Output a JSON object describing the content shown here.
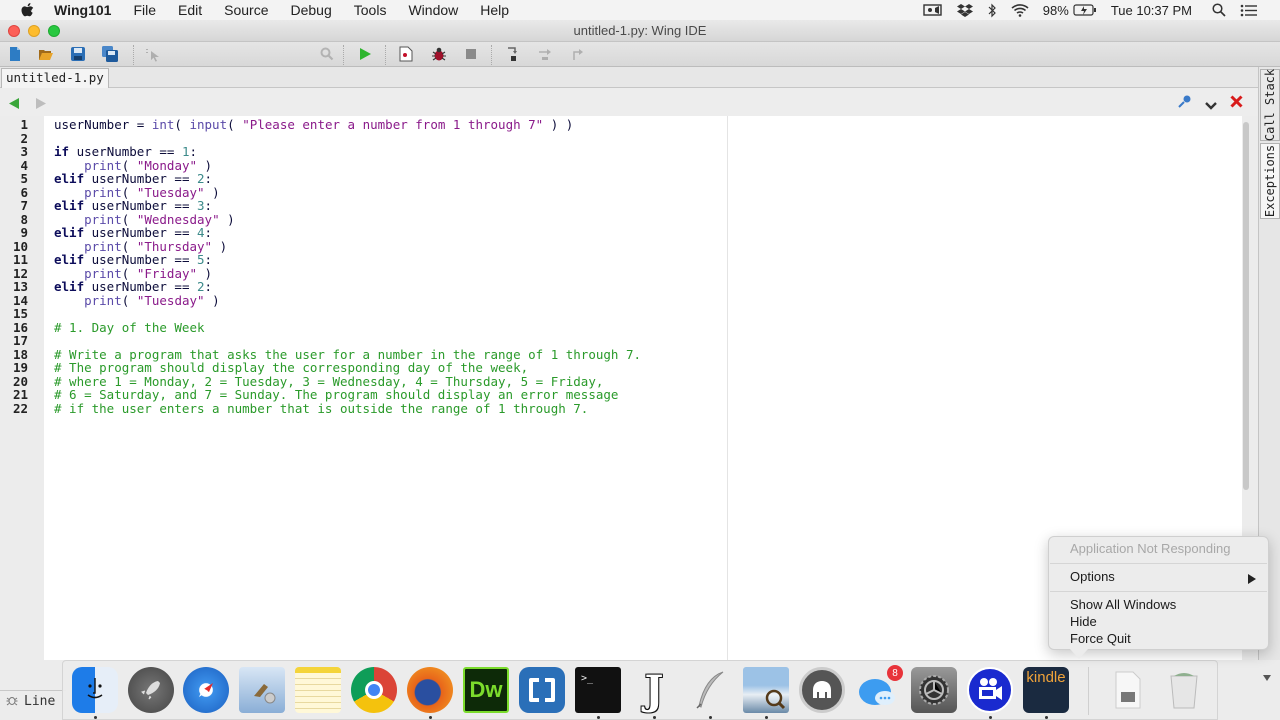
{
  "menubar": {
    "app_name": "Wing101",
    "items": [
      "File",
      "Edit",
      "Source",
      "Debug",
      "Tools",
      "Window",
      "Help"
    ],
    "battery": "98%",
    "clock": "Tue 10:37 PM",
    "status_icons": [
      "screen-record-icon",
      "dropbox-icon",
      "bluetooth-icon",
      "wifi-icon",
      "battery-icon",
      "spotlight-icon",
      "notification-center-icon"
    ]
  },
  "window": {
    "title": "untitled-1.py: Wing IDE"
  },
  "toolbar": {
    "search_value": "",
    "buttons": [
      "new-file",
      "open-file",
      "save",
      "save-all",
      "pointer",
      "search",
      "run",
      "debug-file",
      "debug",
      "stop",
      "step-into",
      "step-over",
      "step-out"
    ]
  },
  "editor": {
    "tab_label": "untitled-1.py",
    "line_numbers": [
      "1",
      "2",
      "3",
      "4",
      "5",
      "6",
      "7",
      "8",
      "9",
      "10",
      "11",
      "12",
      "13",
      "14",
      "15",
      "16",
      "17",
      "18",
      "19",
      "20",
      "21",
      "22"
    ],
    "lines": [
      {
        "parts": [
          [
            "id",
            "userNumber = "
          ],
          [
            "bi",
            "int"
          ],
          [
            "id",
            "( "
          ],
          [
            "bi",
            "input"
          ],
          [
            "id",
            "( "
          ],
          [
            "str",
            "\"Please enter a number from 1 through 7\""
          ],
          [
            "id",
            " ) )"
          ]
        ]
      },
      {
        "parts": []
      },
      {
        "parts": [
          [
            "kw",
            "if"
          ],
          [
            "id",
            " userNumber == "
          ],
          [
            "num",
            "1"
          ],
          [
            "id",
            ":"
          ]
        ]
      },
      {
        "parts": [
          [
            "id",
            "    "
          ],
          [
            "bi",
            "print"
          ],
          [
            "id",
            "( "
          ],
          [
            "str",
            "\"Monday\""
          ],
          [
            "id",
            " )"
          ]
        ]
      },
      {
        "parts": [
          [
            "kw",
            "elif"
          ],
          [
            "id",
            " userNumber == "
          ],
          [
            "num",
            "2"
          ],
          [
            "id",
            ":"
          ]
        ]
      },
      {
        "parts": [
          [
            "id",
            "    "
          ],
          [
            "bi",
            "print"
          ],
          [
            "id",
            "( "
          ],
          [
            "str",
            "\"Tuesday\""
          ],
          [
            "id",
            " )"
          ]
        ]
      },
      {
        "parts": [
          [
            "kw",
            "elif"
          ],
          [
            "id",
            " userNumber == "
          ],
          [
            "num",
            "3"
          ],
          [
            "id",
            ":"
          ]
        ]
      },
      {
        "parts": [
          [
            "id",
            "    "
          ],
          [
            "bi",
            "print"
          ],
          [
            "id",
            "( "
          ],
          [
            "str",
            "\"Wednesday\""
          ],
          [
            "id",
            " )"
          ]
        ]
      },
      {
        "parts": [
          [
            "kw",
            "elif"
          ],
          [
            "id",
            " userNumber == "
          ],
          [
            "num",
            "4"
          ],
          [
            "id",
            ":"
          ]
        ]
      },
      {
        "parts": [
          [
            "id",
            "    "
          ],
          [
            "bi",
            "print"
          ],
          [
            "id",
            "( "
          ],
          [
            "str",
            "\"Thursday\""
          ],
          [
            "id",
            " )"
          ]
        ]
      },
      {
        "parts": [
          [
            "kw",
            "elif"
          ],
          [
            "id",
            " userNumber == "
          ],
          [
            "num",
            "5"
          ],
          [
            "id",
            ":"
          ]
        ]
      },
      {
        "parts": [
          [
            "id",
            "    "
          ],
          [
            "bi",
            "print"
          ],
          [
            "id",
            "( "
          ],
          [
            "str",
            "\"Friday\""
          ],
          [
            "id",
            " )"
          ]
        ]
      },
      {
        "parts": [
          [
            "kw",
            "elif"
          ],
          [
            "id",
            " userNumber == "
          ],
          [
            "num",
            "2"
          ],
          [
            "id",
            ":"
          ]
        ]
      },
      {
        "parts": [
          [
            "id",
            "    "
          ],
          [
            "bi",
            "print"
          ],
          [
            "id",
            "( "
          ],
          [
            "str",
            "\"Tuesday\""
          ],
          [
            "id",
            " )"
          ]
        ]
      },
      {
        "parts": []
      },
      {
        "parts": [
          [
            "cm",
            "# 1. Day of the Week"
          ]
        ]
      },
      {
        "parts": []
      },
      {
        "parts": [
          [
            "cm",
            "# Write a program that asks the user for a number in the range of 1 through 7."
          ]
        ]
      },
      {
        "parts": [
          [
            "cm",
            "# The program should display the corresponding day of the week,"
          ]
        ]
      },
      {
        "parts": [
          [
            "cm",
            "# where 1 = Monday, 2 = Tuesday, 3 = Wednesday, 4 = Thursday, 5 = Friday,"
          ]
        ]
      },
      {
        "parts": [
          [
            "cm",
            "# 6 = Saturday, and 7 = Sunday. The program should display an error message"
          ]
        ]
      },
      {
        "parts": [
          [
            "cm",
            "# if the user enters a number that is outside the range of 1 through 7."
          ]
        ]
      }
    ]
  },
  "side_tabs": {
    "call_stack": "Call Stack",
    "exceptions": "Exceptions"
  },
  "statusbar": {
    "text": "Line"
  },
  "context_menu": {
    "header": "Application Not Responding",
    "options": "Options",
    "show_all_windows": "Show All Windows",
    "hide": "Hide",
    "force_quit": "Force Quit"
  },
  "dock": {
    "items": [
      {
        "name": "Finder",
        "running": true
      },
      {
        "name": "Launchpad",
        "running": false
      },
      {
        "name": "Safari",
        "running": false
      },
      {
        "name": "Mail",
        "running": false
      },
      {
        "name": "Notes",
        "running": false
      },
      {
        "name": "Chrome",
        "running": false
      },
      {
        "name": "Firefox",
        "running": true
      },
      {
        "name": "Dreamweaver",
        "label": "Dw",
        "running": false
      },
      {
        "name": "Brackets",
        "running": false
      },
      {
        "name": "Terminal",
        "label": ">_",
        "running": true
      },
      {
        "name": "jGRASP",
        "label": "J",
        "running": true
      },
      {
        "name": "Quill",
        "running": true
      },
      {
        "name": "Preview",
        "running": true
      },
      {
        "name": "Sequel Pro",
        "running": false
      },
      {
        "name": "Messages",
        "badge": "8",
        "running": false
      },
      {
        "name": "System Preferences",
        "running": false
      },
      {
        "name": "Screen Recorder",
        "running": true
      },
      {
        "name": "Kindle",
        "label": "kindle",
        "running": true
      },
      {
        "name": "Document",
        "running": false
      },
      {
        "name": "Trash",
        "running": false
      }
    ]
  },
  "colors": {
    "keyword": "#0c0c5a",
    "builtin": "#5a4aa8",
    "string": "#8a1a8a",
    "number": "#3c8a8a",
    "comment": "#2a9a2a",
    "close_red": "#d81b1b",
    "run_green": "#2fb52f"
  }
}
